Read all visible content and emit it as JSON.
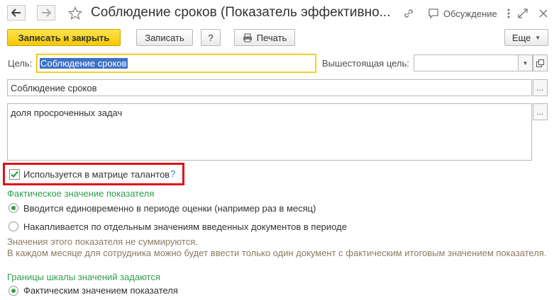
{
  "window": {
    "title": "Соблюдение сроков (Показатель эффективно...",
    "discussion_label": "Обсуждение"
  },
  "toolbar": {
    "save_close_label": "Записать и закрыть",
    "save_label": "Записать",
    "help_label": "?",
    "print_label": "Печать",
    "more_label": "Еще"
  },
  "form": {
    "goal_label": "Цель:",
    "goal_value": "Соблюдение сроков",
    "parent_goal_label": "Вышестоящая цель:",
    "parent_goal_value": "",
    "name_value": "Соблюдение сроков",
    "description_value": "доля просроченных задач",
    "talent_matrix_label": "Используется в матрице талантов",
    "talent_matrix_checked": true,
    "talent_matrix_help": "?"
  },
  "actual_value": {
    "heading": "Фактическое значение показателя",
    "options": [
      {
        "label": "Вводится единовременно в периоде оценки (например раз в месяц)",
        "selected": true
      },
      {
        "label": "Накапливается по отдельным значениям введенных документов в периоде",
        "selected": false
      }
    ],
    "note_line1": "Значения этого показателя не суммируются.",
    "note_line2": "В каждом месяце для сотрудника можно будет ввести только один документ с фактическим итоговым значением показателя."
  },
  "scale_bounds": {
    "heading": "Границы шкалы значений задаются",
    "options": [
      {
        "label": "Фактическим значением показателя",
        "selected": true
      }
    ]
  },
  "colors": {
    "primary_button": "#f4c900",
    "section_heading": "#2e9e4a",
    "note_text": "#8a7a62",
    "highlight_border": "#e3101a",
    "selection": "#3d72c8"
  }
}
